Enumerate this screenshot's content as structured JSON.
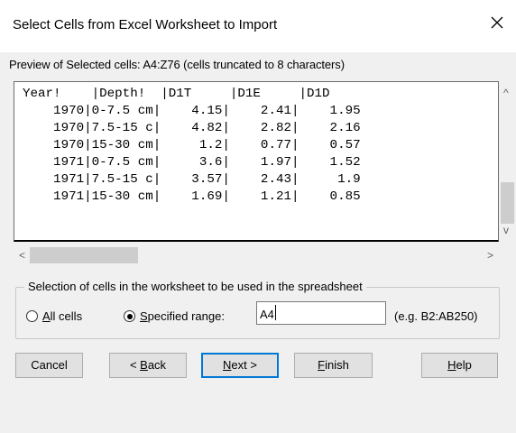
{
  "dialog": {
    "title": "Select Cells from Excel Worksheet to Import"
  },
  "preview": {
    "label": "Preview of Selected cells: A4:Z76 (cells truncated to 8 characters)",
    "rows": [
      "Year!    |Depth!  |D1T     |D1E     |D1D",
      "    1970|0-7.5 cm|    4.15|    2.41|    1.95",
      "    1970|7.5-15 c|    4.82|    2.82|    2.16",
      "    1970|15-30 cm|     1.2|    0.77|    0.57",
      "    1971|0-7.5 cm|     3.6|    1.97|    1.52",
      "    1971|7.5-15 c|    3.57|    2.43|     1.9",
      "    1971|15-30 cm|    1.69|    1.21|    0.85"
    ]
  },
  "scrollbar": {
    "up": "^",
    "down": "v",
    "left": "<",
    "right": ">"
  },
  "selection": {
    "group_label": "Selection of cells in the worksheet to be used in the spreadsheet",
    "all_cells": {
      "accel": "A",
      "rest": "ll cells",
      "checked": false
    },
    "specified_range": {
      "accel": "S",
      "rest": "pecified range:",
      "checked": true
    },
    "range_value": "A4",
    "hint": "(e.g. B2:AB250)"
  },
  "buttons": {
    "cancel": "Cancel",
    "back_prefix": "< ",
    "back_accel": "B",
    "back_rest": "ack",
    "next_accel": "N",
    "next_rest": "ext >",
    "finish_accel": "F",
    "finish_rest": "inish",
    "help_accel": "H",
    "help_rest": "elp"
  },
  "colors": {
    "default_button_border": "#0078d7",
    "background": "#f0f0f0"
  }
}
